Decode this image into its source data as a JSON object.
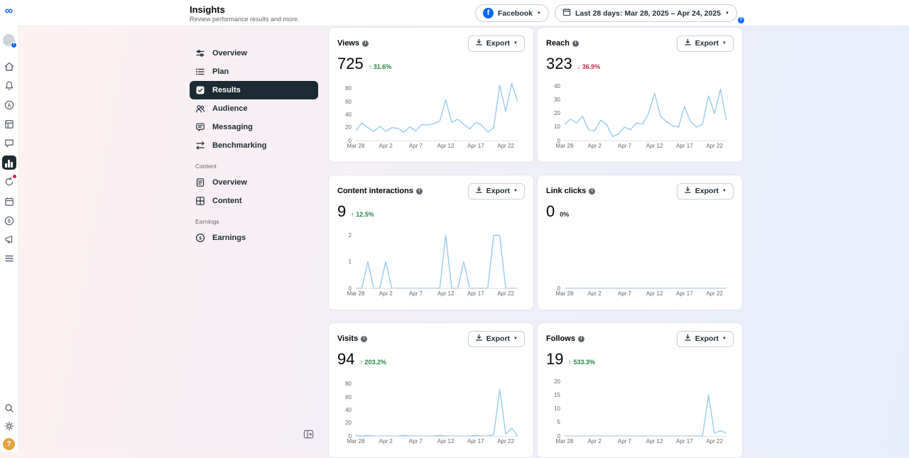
{
  "topbar": {
    "title": "Insights",
    "subtitle": "Review performance results and more.",
    "facebook_button": {
      "label": "Facebook"
    },
    "date_range_button": {
      "label": "Last 28 days: Mar 28, 2025 – Apr 24, 2025"
    }
  },
  "sidebar": {
    "main_items": [
      {
        "label": "Overview"
      },
      {
        "label": "Plan"
      },
      {
        "label": "Results",
        "selected": true
      },
      {
        "label": "Audience"
      },
      {
        "label": "Messaging"
      },
      {
        "label": "Benchmarking"
      }
    ],
    "sections": [
      {
        "label": "Content",
        "items": [
          {
            "label": "Overview"
          },
          {
            "label": "Content"
          }
        ]
      },
      {
        "label": "Earnings",
        "items": [
          {
            "label": "Earnings"
          }
        ]
      }
    ]
  },
  "icons": {
    "meta_logo": "∞",
    "facebook_f": "f",
    "info_i": "i",
    "caret": "▼",
    "dollar": "$",
    "letter_a": "A",
    "question_mark": "?"
  },
  "colors": {
    "facebook_blue": "#0866ff",
    "positive": "#1d8841",
    "negative": "#c22b4a",
    "neutral_text": "#1c2b33",
    "chart_line": "#8ec9f0",
    "nav_selected_bg": "#1c2b33"
  },
  "cards": [
    {
      "title": "Views",
      "value": "725",
      "delta_text": "↑ 31.6%",
      "delta_direction": "up",
      "export_label": "Export",
      "chart": {
        "type": "line",
        "ylim": [
          0,
          92
        ],
        "y_ticks": [
          0,
          20,
          40,
          60,
          80
        ],
        "x_ticks": [
          "Mar 28",
          "Apr 2",
          "Apr 7",
          "Apr 12",
          "Apr 17",
          "Apr 22"
        ],
        "x_tick_days": [
          0,
          5,
          10,
          15,
          20,
          25
        ],
        "values": [
          15,
          27,
          20,
          14,
          22,
          14,
          20,
          19,
          13,
          21,
          15,
          25,
          24,
          26,
          30,
          63,
          28,
          33,
          25,
          18,
          28,
          24,
          13,
          20,
          85,
          45,
          88,
          60
        ]
      }
    },
    {
      "title": "Reach",
      "value": "323",
      "delta_text": "↓ 36.9%",
      "delta_direction": "down",
      "export_label": "Export",
      "chart": {
        "type": "line",
        "ylim": [
          0,
          44
        ],
        "y_ticks": [
          0,
          10,
          20,
          30,
          40
        ],
        "x_ticks": [
          "Mar 28",
          "Apr 2",
          "Apr 7",
          "Apr 12",
          "Apr 17",
          "Apr 22"
        ],
        "x_tick_days": [
          0,
          5,
          10,
          15,
          20,
          25
        ],
        "values": [
          12,
          16,
          13,
          18,
          8,
          7,
          15,
          12,
          3,
          5,
          10,
          8,
          13,
          12,
          20,
          35,
          18,
          14,
          11,
          10,
          25,
          14,
          10,
          12,
          33,
          20,
          38,
          15
        ]
      }
    },
    {
      "title": "Content interactions",
      "value": "9",
      "delta_text": "↑ 12.5%",
      "delta_direction": "up",
      "export_label": "Export",
      "chart": {
        "type": "line",
        "ylim": [
          0,
          2.25
        ],
        "y_ticks": [
          0,
          1,
          2
        ],
        "x_ticks": [
          "Mar 28",
          "Apr 2",
          "Apr 7",
          "Apr 12",
          "Apr 17",
          "Apr 22"
        ],
        "x_tick_days": [
          0,
          5,
          10,
          15,
          20,
          25
        ],
        "values": [
          0,
          0,
          1,
          0,
          0,
          1,
          0,
          0,
          0,
          0,
          0,
          0,
          0,
          0,
          0,
          2,
          0,
          0,
          1,
          0,
          0,
          0,
          0,
          2,
          2,
          0,
          0,
          0
        ]
      }
    },
    {
      "title": "Link clicks",
      "value": "0",
      "delta_text": "0%",
      "delta_direction": "neutral",
      "export_label": "Export",
      "chart": {
        "type": "line",
        "ylim": [
          0,
          1
        ],
        "y_ticks": [
          0
        ],
        "x_ticks": [
          "Mar 28",
          "Apr 2",
          "Apr 7",
          "Apr 12",
          "Apr 17",
          "Apr 22"
        ],
        "x_tick_days": [
          0,
          5,
          10,
          15,
          20,
          25
        ],
        "values": [
          0,
          0,
          0,
          0,
          0,
          0,
          0,
          0,
          0,
          0,
          0,
          0,
          0,
          0,
          0,
          0,
          0,
          0,
          0,
          0,
          0,
          0,
          0,
          0,
          0,
          0,
          0,
          0
        ]
      }
    },
    {
      "title": "Visits",
      "value": "94",
      "delta_text": "↑ 203.2%",
      "delta_direction": "up",
      "export_label": "Export",
      "chart": {
        "type": "line",
        "ylim": [
          0,
          92
        ],
        "y_ticks": [
          0,
          20,
          40,
          60,
          80
        ],
        "x_ticks": [
          "Mar 28",
          "Apr 2",
          "Apr 7",
          "Apr 12",
          "Apr 17",
          "Apr 22"
        ],
        "x_tick_days": [
          0,
          5,
          10,
          15,
          20,
          25
        ],
        "values": [
          1,
          0,
          1,
          0,
          0,
          0,
          0,
          0,
          1,
          0,
          0,
          0,
          0,
          0,
          1,
          0,
          0,
          0,
          0,
          0,
          1,
          0,
          0,
          2,
          72,
          3,
          12,
          0
        ]
      }
    },
    {
      "title": "Follows",
      "value": "19",
      "delta_text": "↑ 533.3%",
      "delta_direction": "up",
      "export_label": "Export",
      "chart": {
        "type": "line",
        "ylim": [
          0,
          22
        ],
        "y_ticks": [
          0,
          5,
          10,
          15,
          20
        ],
        "x_ticks": [
          "Mar 28",
          "Apr 2",
          "Apr 7",
          "Apr 12",
          "Apr 17",
          "Apr 22"
        ],
        "x_tick_days": [
          0,
          5,
          10,
          15,
          20,
          25
        ],
        "values": [
          0,
          0,
          0,
          0,
          0,
          0,
          0,
          0,
          0,
          0,
          0,
          0,
          0,
          0,
          0,
          0,
          0,
          0,
          0,
          0,
          0,
          0,
          0,
          0,
          15,
          1,
          2,
          1
        ]
      }
    }
  ]
}
